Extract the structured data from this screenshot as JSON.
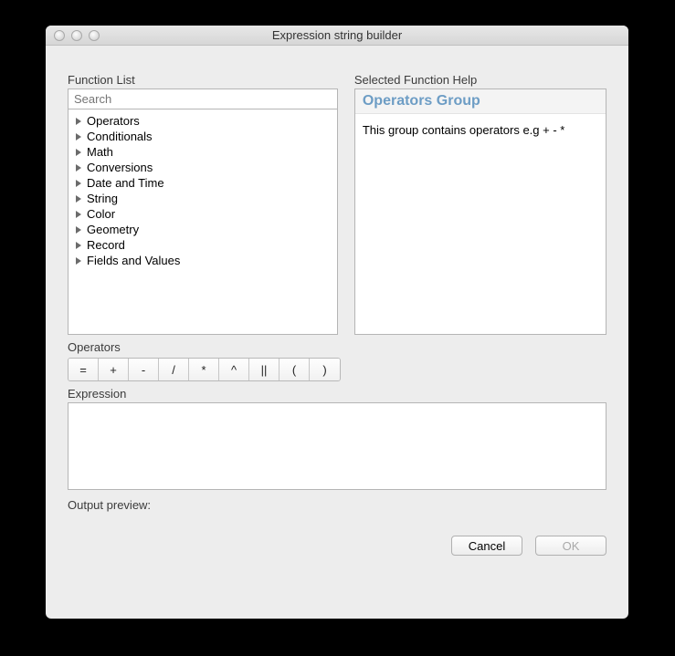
{
  "window": {
    "title": "Expression string builder"
  },
  "functionList": {
    "label": "Function List",
    "searchPlaceholder": "Search",
    "items": [
      "Operators",
      "Conditionals",
      "Math",
      "Conversions",
      "Date and Time",
      "String",
      "Color",
      "Geometry",
      "Record",
      "Fields and Values"
    ]
  },
  "help": {
    "label": "Selected Function Help",
    "title": "Operators Group",
    "body": "This group contains operators e.g + - *"
  },
  "operators": {
    "label": "Operators",
    "buttons": [
      "=",
      "+",
      "-",
      "/",
      "*",
      "^",
      "||",
      "(",
      ")"
    ]
  },
  "expression": {
    "label": "Expression",
    "value": ""
  },
  "preview": {
    "label": "Output preview:"
  },
  "buttons": {
    "cancel": "Cancel",
    "ok": "OK"
  }
}
